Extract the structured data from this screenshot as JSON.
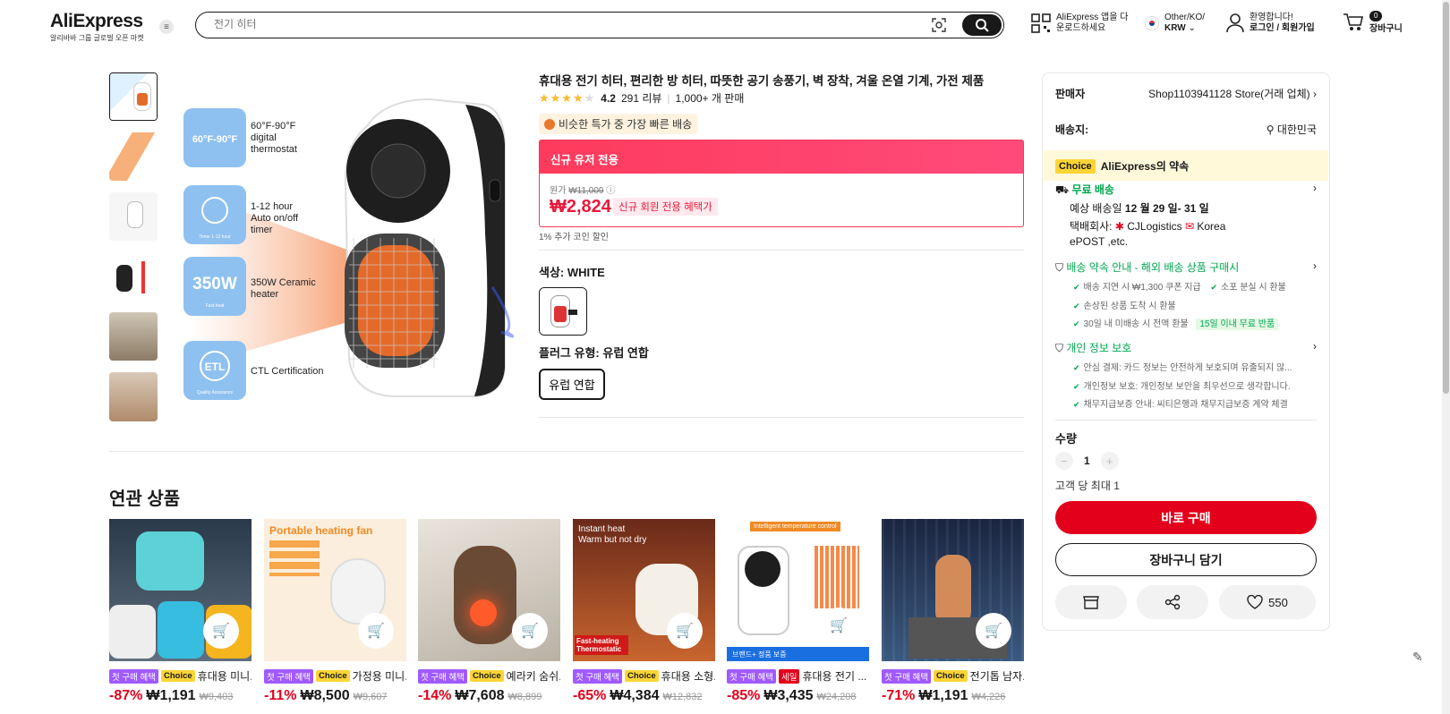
{
  "header": {
    "logo": "AliExpress",
    "logo_sub": "알리바바 그룹 글로벌 오픈 마켓",
    "search_placeholder": "전기 히터",
    "app_line1": "AliExpress 앱을 다",
    "app_line2": "운로드하세요",
    "region_line1": "Other/KO/",
    "region_line2": "KRW",
    "user_line1": "환영합니다!",
    "user_line2": "로그인 / 회원가입",
    "cart_count": "0",
    "cart_label": "장바구니"
  },
  "gallery": {
    "feature1_badge": "60°F-90°F",
    "feature1_text": "60°F-90°F digital thermostat",
    "feature2_badge": "Timer 1-12 hour",
    "feature2_text": "1-12 hour Auto on/off timer",
    "feature3_badge": "350W",
    "feature3_sub": "Fast heat",
    "feature3_text": "350W Ceramic heater",
    "feature4_badge": "ETL",
    "feature4_sub": "Quality Assurance",
    "feature4_text": "CTL Certification"
  },
  "product": {
    "title": "휴대용 전기 히터, 편리한 방 히터, 따뜻한 공기 송풍기, 벽 장착, 겨울 온열 기계, 가전 제품",
    "rating": "4.2",
    "reviews": "291 리뷰",
    "sold": "1,000+ 개 판매",
    "bigsale": "비슷한 특가 중 가장 빠른 배송",
    "promo_header": "신규 유저 전용",
    "orig_label": "원가",
    "orig_price": "₩11,009",
    "price": "₩2,824",
    "price_tag": "신규 회원 전용 혜택가",
    "coin": "1% 추가 코인 할인",
    "color_label": "색상: WHITE",
    "plug_label": "플러그 유형: 유럽 연합",
    "plug_value": "유럽 연합"
  },
  "panel": {
    "seller_label": "판매자",
    "seller_value": "Shop1103941128 Store(거래 업체)",
    "ship_to_label": "배송지:",
    "ship_to_value": "대한민국",
    "choice_badge": "Choice",
    "choice_text": "AliExpress의 약속",
    "free_ship": "무료 배송",
    "eta_prefix": "예상 배송일",
    "eta_date": "12 월 29 일- 31 일",
    "carrier_label": "택배회사:",
    "carrier1": "CJLogistics",
    "carrier2": "Korea",
    "carrier2b": "ePOST ,etc.",
    "promise_title": "배송 약속 안내 - 해외 배송 상품 구매시",
    "promise1": "배송 지연 시 ₩1,300 쿠폰 지급",
    "promise2": "소포 분실 시 환불",
    "promise3": "손상된 상품 도착 시 환불",
    "promise4": "30일 내 미배송 시 전액 환불",
    "promise4_tag": "15일 이내 무료 반품",
    "privacy_title": "개인 정보 보호",
    "privacy1": "안심 결제: 카드 정보는 안전하게 보호되며 유출되지 않...",
    "privacy2": "개인정보 보호: 개인정보 보안을 최우선으로 생각합니다.",
    "privacy3": "채무지급보증 안내: 씨티은행과 채무지급보증 계약 체결",
    "qty_label": "수량",
    "qty_minus": "−",
    "qty_value": "1",
    "qty_plus": "+",
    "qty_max": "고객 당 최대 1",
    "buy_now": "바로 구매",
    "add_cart": "장바구니 담기",
    "likes": "550"
  },
  "related": {
    "title": "연관 상품",
    "items": [
      {
        "tag1": "첫 구매 혜택",
        "tag2": "Choice",
        "name": "휴대용 미니...",
        "disc": "-87%",
        "price": "₩1,191",
        "old": "₩9,403"
      },
      {
        "tag1": "첫 구매 혜택",
        "tag2": "Choice",
        "name": "가정용 미니...",
        "disc": "-11%",
        "price": "₩8,500",
        "old": "₩9,607",
        "img_text": "Portable heating fan"
      },
      {
        "tag1": "첫 구매 혜택",
        "tag2": "Choice",
        "name": "예라키 숨쉬...",
        "disc": "-14%",
        "price": "₩7,608",
        "old": "₩8,899"
      },
      {
        "tag1": "첫 구매 혜택",
        "tag2": "Choice",
        "name": "휴대용 소형...",
        "disc": "-65%",
        "price": "₩4,384",
        "old": "₩12,832",
        "img_text": "Instant heat Warm but not dry",
        "img_text2": "Fast-heating Thermostatic"
      },
      {
        "tag1": "첫 구매 혜택",
        "tag2": "세일",
        "name": "휴대용 전기 ...",
        "disc": "-85%",
        "price": "₩3,435",
        "old": "₩24,208",
        "img_text": "Intelligent temperature control",
        "img_text2": "브랜드+ 정품 보증"
      },
      {
        "tag1": "첫 구매 혜택",
        "tag2": "Choice",
        "name": "전기톱 남자...",
        "disc": "-71%",
        "price": "₩1,191",
        "old": "₩4,226"
      }
    ]
  }
}
